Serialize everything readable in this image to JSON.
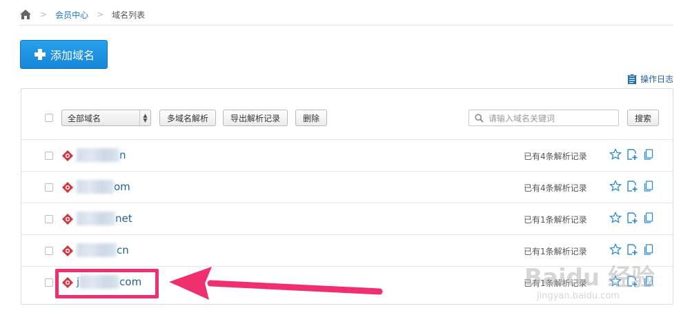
{
  "breadcrumb": {
    "home_icon": "home-icon",
    "member_center": "会员中心",
    "current": "域名列表"
  },
  "add_domain_label": "添加域名",
  "ops_log_label": "操作日志",
  "toolbar": {
    "select_value": "全部域名",
    "multi_resolve": "多域名解析",
    "export_records": "导出解析记录",
    "delete": "删除",
    "search_placeholder": "请输入域名关键词",
    "search": "搜索"
  },
  "domains": [
    {
      "name_suffix": "n",
      "records": "已有4条解析记录"
    },
    {
      "name_suffix": "om",
      "records": "已有4条解析记录"
    },
    {
      "name_suffix": "net",
      "records": "已有1条解析记录"
    },
    {
      "name_suffix": "cn",
      "records": "已有1条解析记录"
    },
    {
      "name_prefix": "j",
      "name_suffix": "com",
      "records": "已有1条解析记录"
    }
  ],
  "watermark": {
    "main": "Baidu 经验",
    "sub": "jingyan.baidu.com"
  },
  "colors": {
    "accent": "#1c78c8",
    "button": "#1a8fdf",
    "highlight": "#f0306e"
  }
}
